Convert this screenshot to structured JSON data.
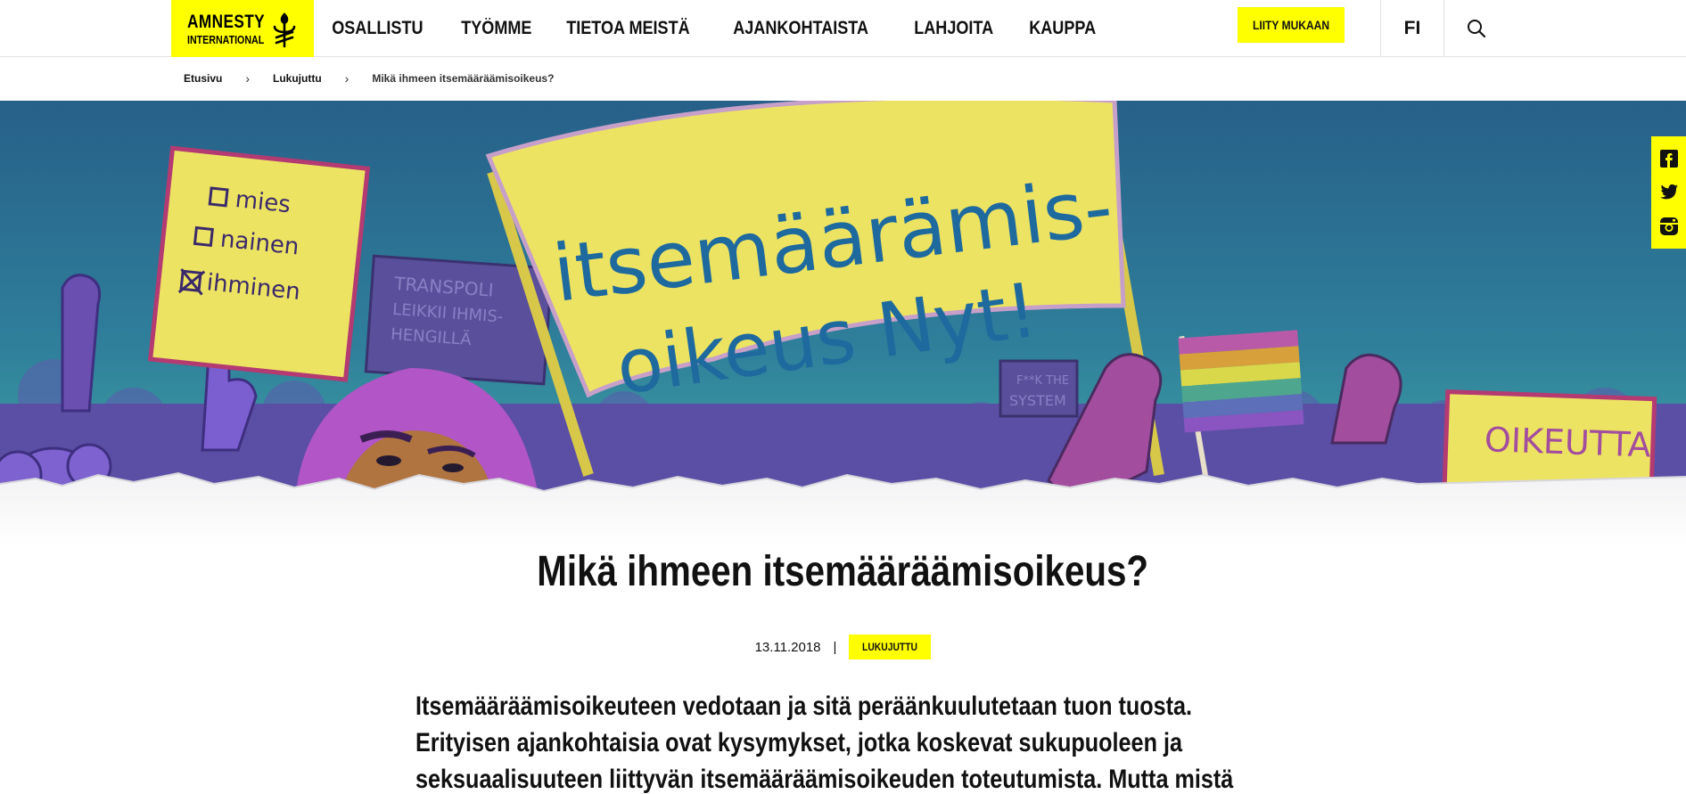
{
  "header": {
    "logo": {
      "line1": "AMNESTY",
      "line2": "INTERNATIONAL"
    },
    "nav": [
      {
        "label": "OSALLISTU"
      },
      {
        "label": "TYÖMME"
      },
      {
        "label": "TIETOA MEISTÄ"
      },
      {
        "label": "AJANKOHTAISTA"
      },
      {
        "label": "LAHJOITA"
      },
      {
        "label": "KAUPPA"
      }
    ],
    "join_label": "LIITY MUKAAN",
    "language": "FI",
    "search_icon": "search-icon"
  },
  "breadcrumb": [
    {
      "label": "Etusivu"
    },
    {
      "label": "Lukujuttu"
    },
    {
      "label": "Mikä ihmeen itsemääräämisoikeus?"
    }
  ],
  "hero": {
    "banner_line1": "itsemäärämis-",
    "banner_line2": "oikeus Nyt!",
    "sign_left": [
      "mies",
      "nainen",
      "ihminen"
    ],
    "sign_transpoli": [
      "TRANSPOLI",
      "LEIKKII IHMIS-",
      "HENGILLÄ"
    ],
    "sign_small": [
      "F**K THE",
      "SYSTEM"
    ],
    "sign_right": "OIKEUTTA"
  },
  "social": [
    "facebook-icon",
    "twitter-icon",
    "instagram-icon"
  ],
  "article": {
    "title": "Mikä ihmeen itsemääräämisoikeus?",
    "date": "13.11.2018",
    "separator": "|",
    "category": "LUKUJUTTU",
    "lead": [
      "Itsemääräämisoikeuteen vedotaan ja sitä peräänkuulutetaan tuon tuosta.",
      "Erityisen ajankohtaisia ovat kysymykset, jotka koskevat sukupuoleen ja",
      "seksuaalisuuteen liittyvän itsemääräämisoikeuden toteutumista. Mutta mistä"
    ]
  },
  "colors": {
    "brand_yellow": "#ffff00",
    "hero_sky_top": "#276089",
    "hero_sky_bottom": "#3fa7a2",
    "banner_yellow": "#ede363",
    "banner_text": "#1e6a9e",
    "purple": "#8a55c0"
  }
}
